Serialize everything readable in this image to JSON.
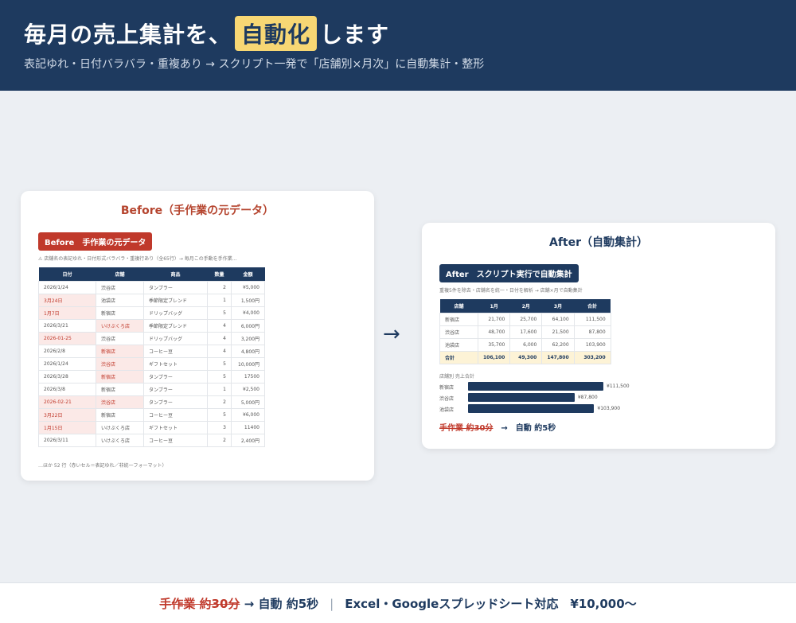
{
  "header": {
    "title_before": "毎月の売上集計を、",
    "title_highlight": "自動化",
    "title_after": "します",
    "subtitle": "表記ゆれ・日付バラバラ・重複あり → スクリプト一発で「店舗別×月次」に自動集計・整形"
  },
  "before": {
    "card_title": "Before（手作業の元データ）",
    "badge": "Before　手作業の元データ",
    "note": "⚠ 店舗名の表記ゆれ・日付形式バラバラ・重複行あり（全65行）→ 毎月この手動を手作業…",
    "headers": [
      "日付",
      "店舗",
      "商品",
      "数量",
      "金額"
    ],
    "rows": [
      {
        "date": "2026/1/24",
        "store": "渋谷店",
        "product": "タンブラー",
        "qty": "2",
        "amount": "¥5,000",
        "date_bad": false,
        "store_bad": false
      },
      {
        "date": "3月24日",
        "store": "池袋店",
        "product": "季節限定ブレンド",
        "qty": "1",
        "amount": "1,500円",
        "date_bad": true,
        "store_bad": false
      },
      {
        "date": "1月7日",
        "store": "新宿店",
        "product": "ドリップバッグ",
        "qty": "5",
        "amount": "¥4,000",
        "date_bad": true,
        "store_bad": false
      },
      {
        "date": "2026/3/21",
        "store": "いけぶくろ店",
        "product": "季節限定ブレンド",
        "qty": "4",
        "amount": "6,000円",
        "date_bad": false,
        "store_bad": true
      },
      {
        "date": "2026-01-25",
        "store": "渋谷店",
        "product": "ドリップバッグ",
        "qty": "4",
        "amount": "3,200円",
        "date_bad": true,
        "store_bad": false
      },
      {
        "date": "2026/2/8",
        "store": "新宿店",
        "product": "コーヒー豆",
        "qty": "4",
        "amount": "4,800円",
        "date_bad": false,
        "store_bad": true
      },
      {
        "date": "2026/1/24",
        "store": "渋谷店",
        "product": "ギフトセット",
        "qty": "5",
        "amount": "10,000円",
        "date_bad": false,
        "store_bad": true
      },
      {
        "date": "2026/3/28",
        "store": "新宿店",
        "product": "タンブラー",
        "qty": "5",
        "amount": "17500",
        "date_bad": false,
        "store_bad": true
      },
      {
        "date": "2026/3/8",
        "store": "新宿店",
        "product": "タンブラー",
        "qty": "1",
        "amount": "¥2,500",
        "date_bad": false,
        "store_bad": false
      },
      {
        "date": "2026-02-21",
        "store": "渋谷店",
        "product": "タンブラー",
        "qty": "2",
        "amount": "5,000円",
        "date_bad": true,
        "store_bad": true
      },
      {
        "date": "3月22日",
        "store": "新宿店",
        "product": "コーヒー豆",
        "qty": "5",
        "amount": "¥6,000",
        "date_bad": true,
        "store_bad": false
      },
      {
        "date": "1月15日",
        "store": "いけぶくろ店",
        "product": "ギフトセット",
        "qty": "3",
        "amount": "11400",
        "date_bad": true,
        "store_bad": false
      },
      {
        "date": "2026/3/11",
        "store": "いけぶくろ店",
        "product": "コーヒー豆",
        "qty": "2",
        "amount": "2,400円",
        "date_bad": false,
        "store_bad": false
      }
    ],
    "footer_note": "…ほか 52 行（赤いセル＝表記ゆれ／非統一フォーマット）"
  },
  "arrow": "→",
  "after": {
    "card_title": "After（自動集計）",
    "badge": "After　スクリプト実行で自動集計",
    "note": "重複5件を除去・店舗名を統一・日付を解析 → 店舗×月で自動集計",
    "headers": [
      "店舗",
      "1月",
      "2月",
      "3月",
      "合計"
    ],
    "rows": [
      [
        "新宿店",
        "21,700",
        "25,700",
        "64,100",
        "111,500"
      ],
      [
        "渋谷店",
        "48,700",
        "17,600",
        "21,500",
        "87,800"
      ],
      [
        "池袋店",
        "35,700",
        "6,000",
        "62,200",
        "103,900"
      ]
    ],
    "total": [
      "合計",
      "106,100",
      "49,300",
      "147,800",
      "303,200"
    ],
    "chart_title": "店舗別 売上合計",
    "foot_manual": "手作業 約30分",
    "foot_arrow": "→",
    "foot_auto": "自動 約5秒"
  },
  "chart_data": {
    "type": "bar",
    "title": "店舗別 売上合計",
    "categories": [
      "新宿店",
      "渋谷店",
      "池袋店"
    ],
    "values": [
      111500,
      87800,
      103900
    ],
    "value_labels": [
      "¥111,500",
      "¥87,800",
      "¥103,900"
    ],
    "orientation": "horizontal"
  },
  "footer": {
    "manual": "手作業 約30分",
    "arrow": "→",
    "auto": "自動 約5秒",
    "divider": "|",
    "compat": "Excel・Googleスプレッドシート対応　¥10,000〜"
  }
}
